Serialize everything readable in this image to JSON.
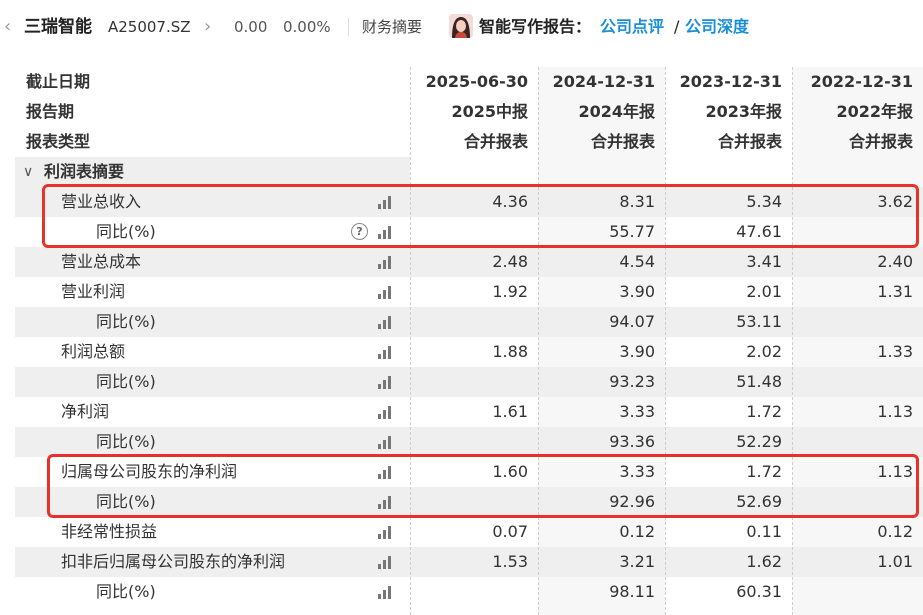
{
  "header": {
    "back_glyph": "‹",
    "company_name": "三瑞智能",
    "stock_code": "A25007.SZ",
    "forward_glyph": "›",
    "price": "0.00",
    "change_pct": "0.00%",
    "financial_summary_tab": "财务摘要",
    "ai_report_title": "智能写作报告：",
    "link_company_review": "公司点评",
    "link_separator": "/",
    "link_company_depth": "公司深度"
  },
  "table": {
    "header_rows": [
      {
        "label": "截止日期",
        "values": [
          "2025-06-30",
          "2024-12-31",
          "2023-12-31",
          "2022-12-31"
        ]
      },
      {
        "label": "报告期",
        "values": [
          "2025中报",
          "2024年报",
          "2023年报",
          "2022年报"
        ]
      },
      {
        "label": "报表类型",
        "values": [
          "合并报表",
          "合并报表",
          "合并报表",
          "合并报表"
        ]
      }
    ],
    "section_title": "利润表摘要",
    "section_chevron": "∨",
    "help_glyph": "?",
    "rows": [
      {
        "label": "营业总收入",
        "indent": 1,
        "values": [
          "4.36",
          "8.31",
          "5.34",
          "3.62"
        ]
      },
      {
        "label": "同比(%)",
        "indent": 2,
        "help": true,
        "values": [
          "",
          "55.77",
          "47.61",
          ""
        ]
      },
      {
        "label": "营业总成本",
        "indent": 1,
        "values": [
          "2.48",
          "4.54",
          "3.41",
          "2.40"
        ]
      },
      {
        "label": "营业利润",
        "indent": 1,
        "values": [
          "1.92",
          "3.90",
          "2.01",
          "1.31"
        ]
      },
      {
        "label": "同比(%)",
        "indent": 2,
        "values": [
          "",
          "94.07",
          "53.11",
          ""
        ]
      },
      {
        "label": "利润总额",
        "indent": 1,
        "values": [
          "1.88",
          "3.90",
          "2.02",
          "1.33"
        ]
      },
      {
        "label": "同比(%)",
        "indent": 2,
        "values": [
          "",
          "93.23",
          "51.48",
          ""
        ]
      },
      {
        "label": "净利润",
        "indent": 1,
        "values": [
          "1.61",
          "3.33",
          "1.72",
          "1.13"
        ]
      },
      {
        "label": "同比(%)",
        "indent": 2,
        "values": [
          "",
          "93.36",
          "52.29",
          ""
        ]
      },
      {
        "label": "归属母公司股东的净利润",
        "indent": 1,
        "values": [
          "1.60",
          "3.33",
          "1.72",
          "1.13"
        ]
      },
      {
        "label": "同比(%)",
        "indent": 2,
        "values": [
          "",
          "92.96",
          "52.69",
          ""
        ]
      },
      {
        "label": "非经常性损益",
        "indent": 1,
        "values": [
          "0.07",
          "0.12",
          "0.11",
          "0.12"
        ]
      },
      {
        "label": "扣非后归属母公司股东的净利润",
        "indent": 1,
        "values": [
          "1.53",
          "3.21",
          "1.62",
          "1.01"
        ]
      },
      {
        "label": "同比(%)",
        "indent": 2,
        "values": [
          "",
          "98.11",
          "60.31",
          ""
        ]
      }
    ]
  },
  "colors": {
    "highlight": "#e8312b",
    "link": "#1b8fd6",
    "row_alt": "#efefef"
  }
}
